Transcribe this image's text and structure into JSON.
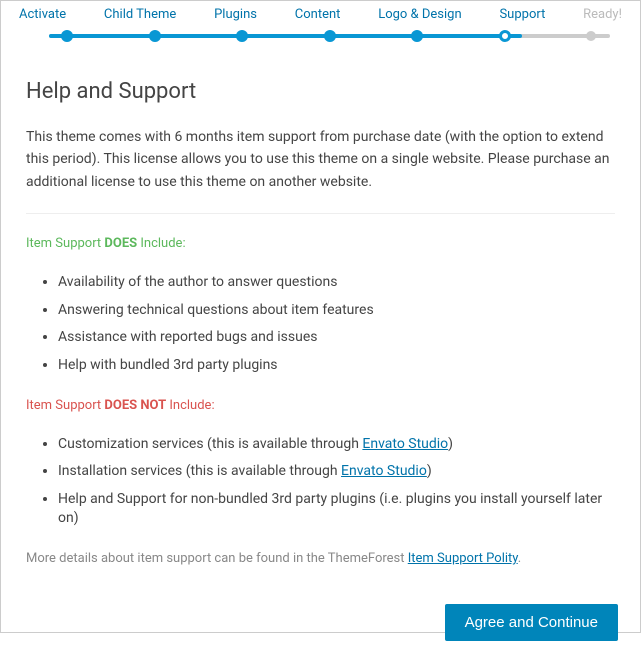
{
  "wizard": {
    "steps": [
      {
        "label": "Activate",
        "state": "done"
      },
      {
        "label": "Child Theme",
        "state": "done"
      },
      {
        "label": "Plugins",
        "state": "done"
      },
      {
        "label": "Content",
        "state": "done"
      },
      {
        "label": "Logo & Design",
        "state": "done"
      },
      {
        "label": "Support",
        "state": "current"
      },
      {
        "label": "Ready!",
        "state": "future"
      }
    ]
  },
  "page": {
    "title": "Help and Support",
    "intro": "This theme comes with 6 months item support from purchase date (with the option to extend this period). This license allows you to use this theme on a single website. Please purchase an additional license to use this theme on another website.",
    "does_label_pre": "Item Support ",
    "does_label_strong": "DOES",
    "does_label_post": " Include:",
    "does_items": [
      "Availability of the author to answer questions",
      "Answering technical questions about item features",
      "Assistance with reported bugs and issues",
      "Help with bundled 3rd party plugins"
    ],
    "doesnot_label_pre": "Item Support ",
    "doesnot_label_strong": "DOES NOT",
    "doesnot_label_post": " Include:",
    "doesnot_items": [
      {
        "pre": "Customization services (this is available through ",
        "link": "Envato Studio",
        "post": ")"
      },
      {
        "pre": "Installation services (this is available through ",
        "link": "Envato Studio",
        "post": ")"
      },
      {
        "pre": "Help and Support for non-bundled 3rd party plugins (i.e. plugins you install yourself later on)",
        "link": "",
        "post": ""
      }
    ],
    "more_pre": "More details about item support can be found in the ThemeForest ",
    "more_link": "Item Support Polity",
    "more_post": ".",
    "button": "Agree and Continue"
  }
}
